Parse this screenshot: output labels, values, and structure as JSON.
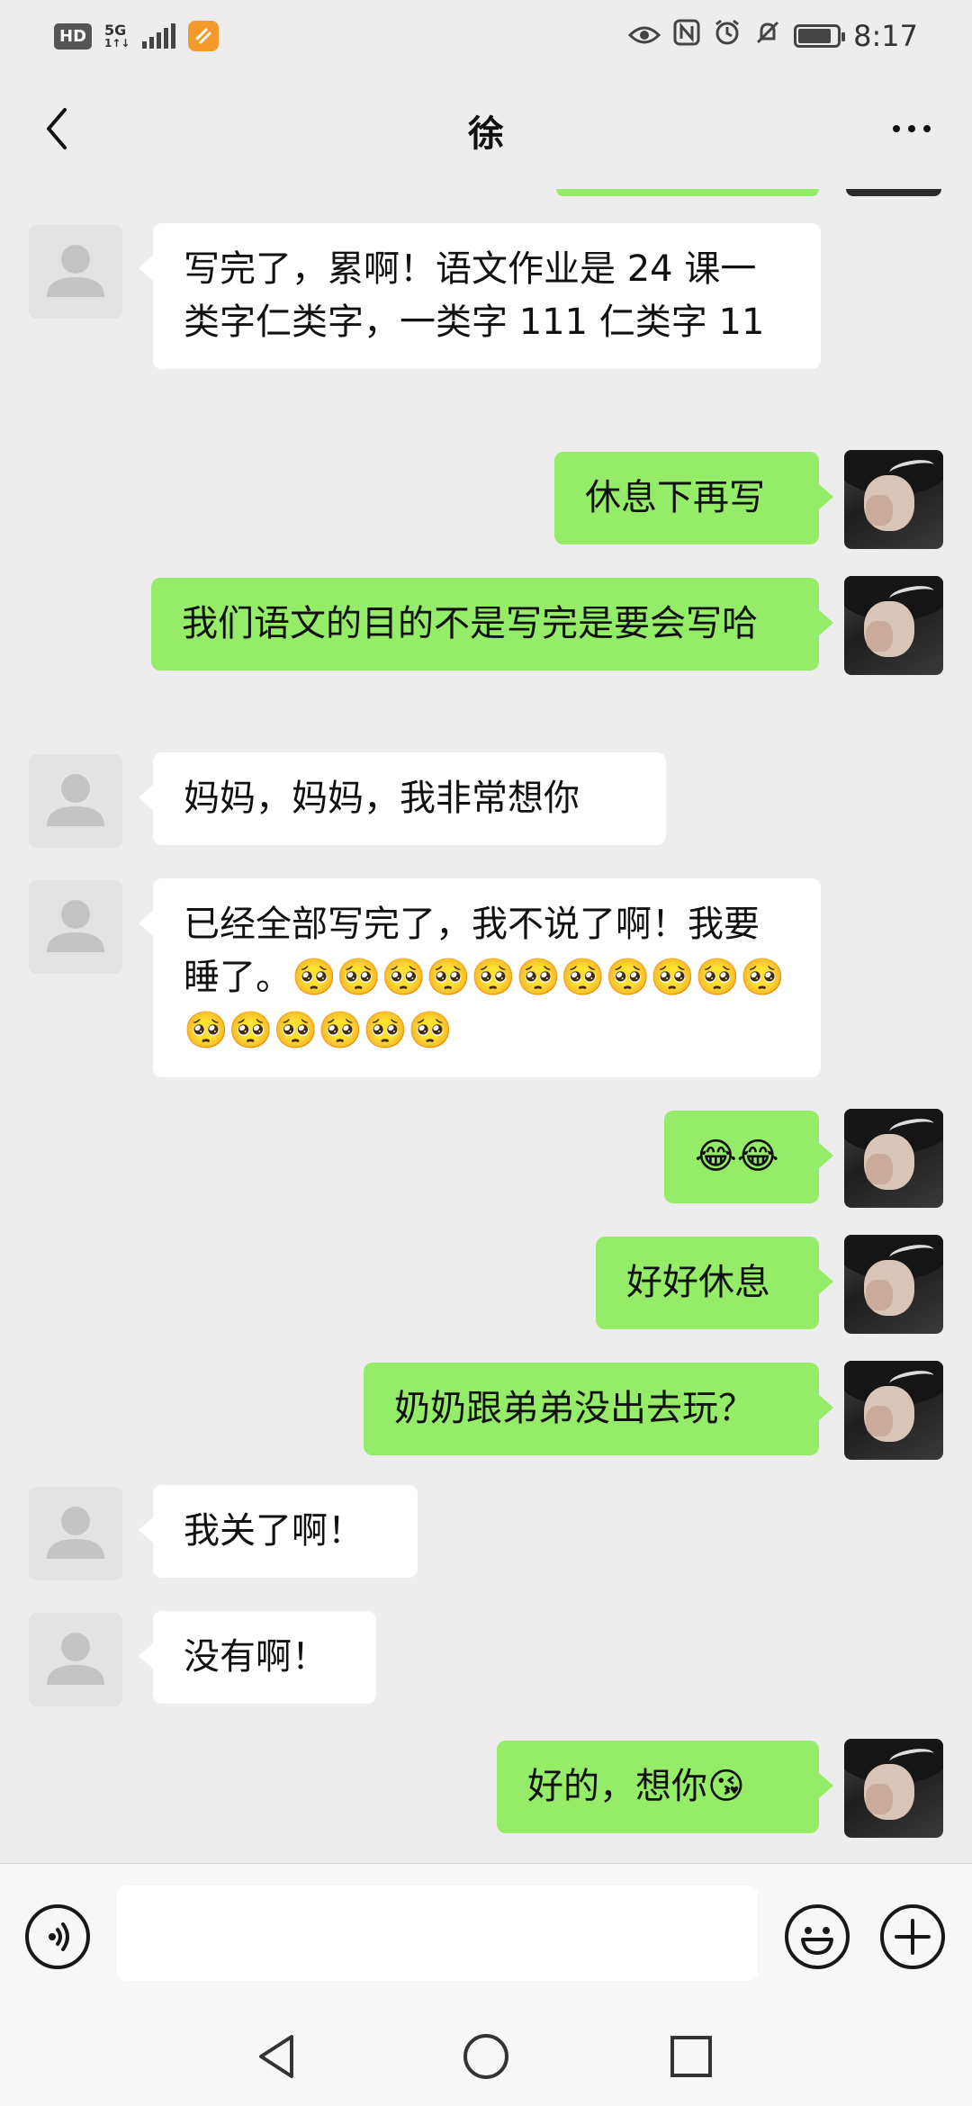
{
  "status_bar": {
    "hd": "HD",
    "network": "5G",
    "network_sub": "1↑↓",
    "time": "8:17",
    "battery_level": 0.85,
    "icons": [
      "eye-icon",
      "nfc-icon",
      "alarm-icon",
      "mute-icon",
      "battery-icon"
    ]
  },
  "header": {
    "title": "徐",
    "back_icon": "chevron-left-icon",
    "more_icon": "more-dots-icon"
  },
  "messages": [
    {
      "side": "left",
      "text": "写完了，累啊！语文作业是 24 课一类字仁类字，一类字 111 仁类字 11"
    },
    {
      "side": "right",
      "text": "休息下再写"
    },
    {
      "side": "right",
      "text": "我们语文的目的不是写完是要会写哈"
    },
    {
      "side": "left",
      "text": "妈妈，妈妈，我非常想你"
    },
    {
      "side": "left",
      "text": "已经全部写完了，我不说了啊！我要睡了。🥺🥺🥺🥺🥺🥺🥺🥺🥺🥺🥺🥺🥺🥺🥺🥺🥺"
    },
    {
      "side": "right",
      "text": "😂😂"
    },
    {
      "side": "right",
      "text": "好好休息"
    },
    {
      "side": "right",
      "text": "奶奶跟弟弟没出去玩？"
    },
    {
      "side": "left",
      "text": "我关了啊！"
    },
    {
      "side": "left",
      "text": "没有啊！"
    },
    {
      "side": "right",
      "text": "好的，想你😘"
    }
  ],
  "input_bar": {
    "voice_icon": "voice-icon",
    "text_value": "",
    "emoji_icon": "emoji-icon",
    "plus_icon": "plus-icon"
  },
  "nav_bar": {
    "icons": [
      "nav-back-icon",
      "nav-home-icon",
      "nav-recents-icon"
    ]
  },
  "colors": {
    "background": "#ededed",
    "bubble_self": "#95ec69",
    "bubble_other": "#ffffff"
  }
}
